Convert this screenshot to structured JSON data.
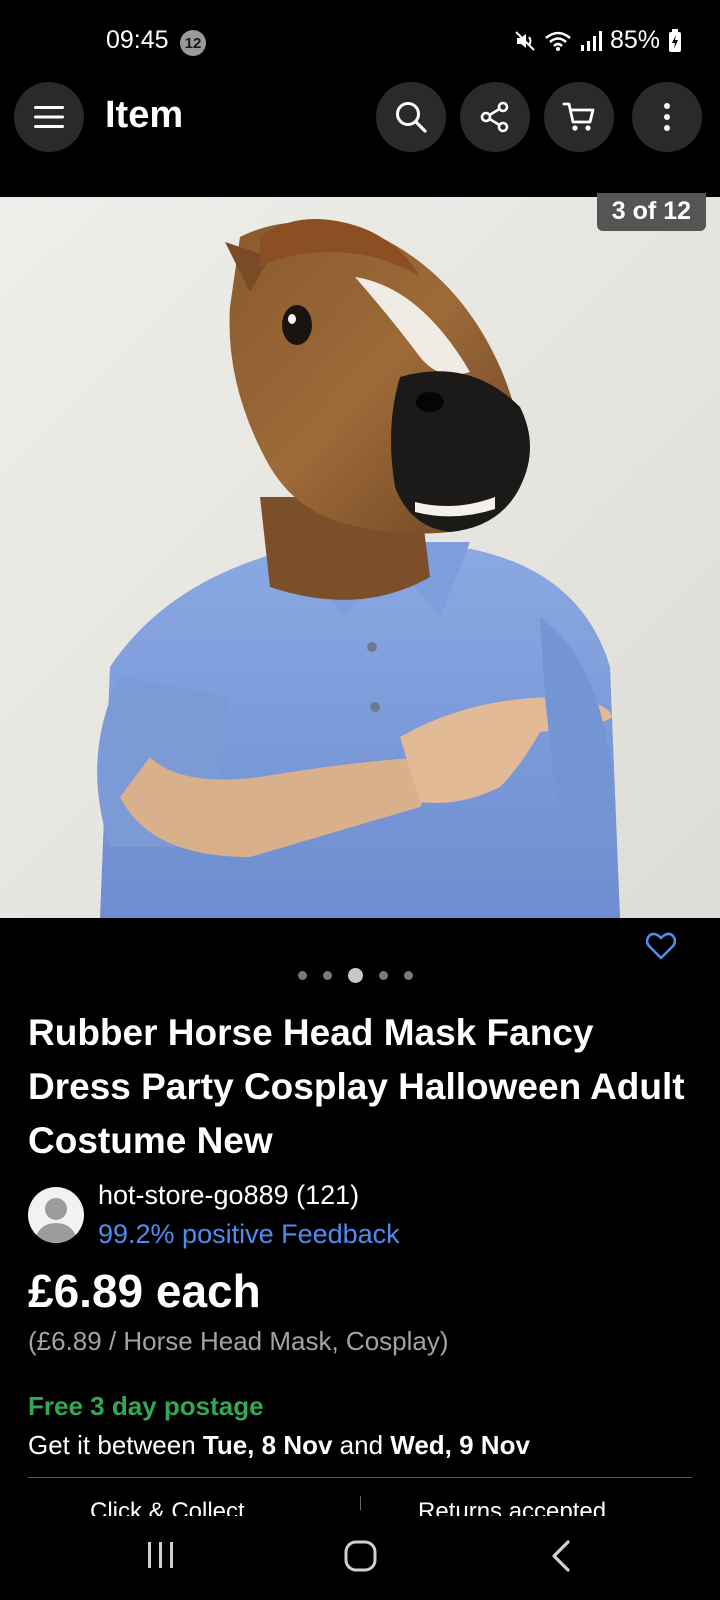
{
  "status_bar": {
    "time": "09:45",
    "notification_count": "12",
    "battery": "85%"
  },
  "app_bar": {
    "title": "Item",
    "icons": [
      "menu-icon",
      "search-icon",
      "share-icon",
      "cart-icon",
      "more-icon"
    ]
  },
  "gallery": {
    "counter": "3 of 12",
    "dots_total": 5,
    "dots_active": 3
  },
  "listing": {
    "title": "Rubber Horse Head Mask Fancy Dress Party Cosplay Halloween Adult Costume New",
    "seller": {
      "name": "hot-store-go889 (121)",
      "feedback": "99.2% positive Feedback"
    },
    "price": "£6.89 each",
    "unit_price": "(£6.89 / Horse Head Mask, Cosplay)",
    "postage": "Free 3 day postage",
    "delivery": {
      "prefix": "Get it between ",
      "date_start": "Tue, 8 Nov",
      "middle": " and ",
      "date_end": "Wed, 9 Nov"
    },
    "next_options": {
      "left": "Click & Collect",
      "right": "Returns accepted"
    }
  },
  "colors": {
    "background": "#000000",
    "link": "#4f8cf2",
    "postage_green": "#32a852",
    "muted": "#a3a3a3"
  }
}
